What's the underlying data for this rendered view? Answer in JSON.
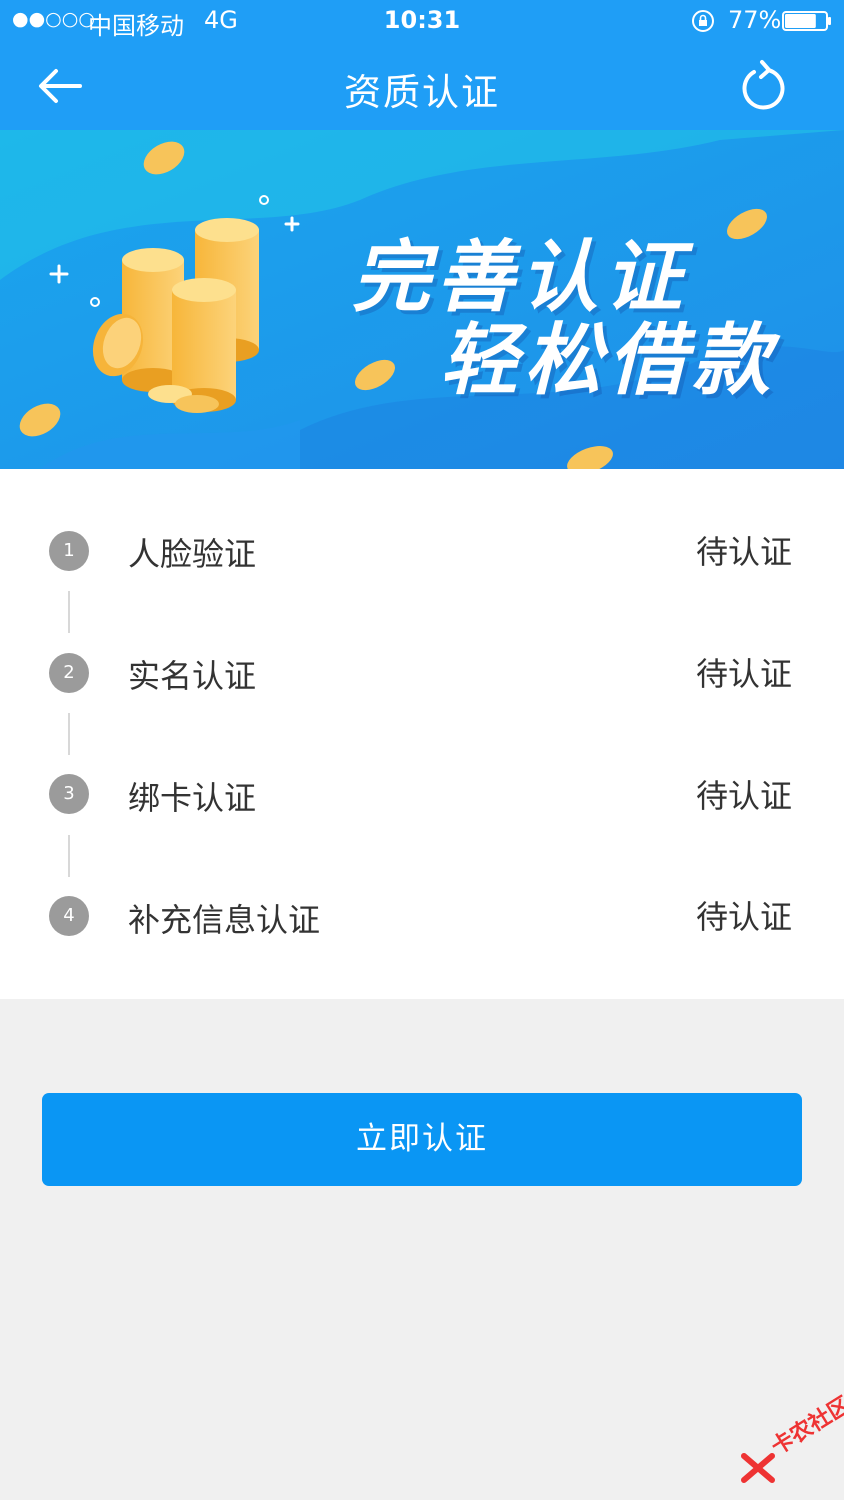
{
  "status_bar": {
    "signal": "●●○○○",
    "carrier": "中国移动",
    "network": "4G",
    "time": "10:31",
    "battery_percent": "77%",
    "battery_level": 0.77
  },
  "nav": {
    "title": "资质认证",
    "back_icon": "back-arrow-icon",
    "refresh_icon": "refresh-icon"
  },
  "banner": {
    "line1": "完善认证",
    "line2": "轻松借款"
  },
  "steps": [
    {
      "number": "1",
      "name": "人脸验证",
      "status": "待认证"
    },
    {
      "number": "2",
      "name": "实名认证",
      "status": "待认证"
    },
    {
      "number": "3",
      "name": "绑卡认证",
      "status": "待认证"
    },
    {
      "number": "4",
      "name": "补充信息认证",
      "status": "待认证"
    }
  ],
  "action": {
    "button_label": "立即认证"
  },
  "watermark": {
    "text": "卡农社区"
  },
  "colors": {
    "primary": "#1f9ef6",
    "button": "#0a96f4",
    "step_circle": "#9b9b9b",
    "page_bg": "#f0f0f0"
  }
}
